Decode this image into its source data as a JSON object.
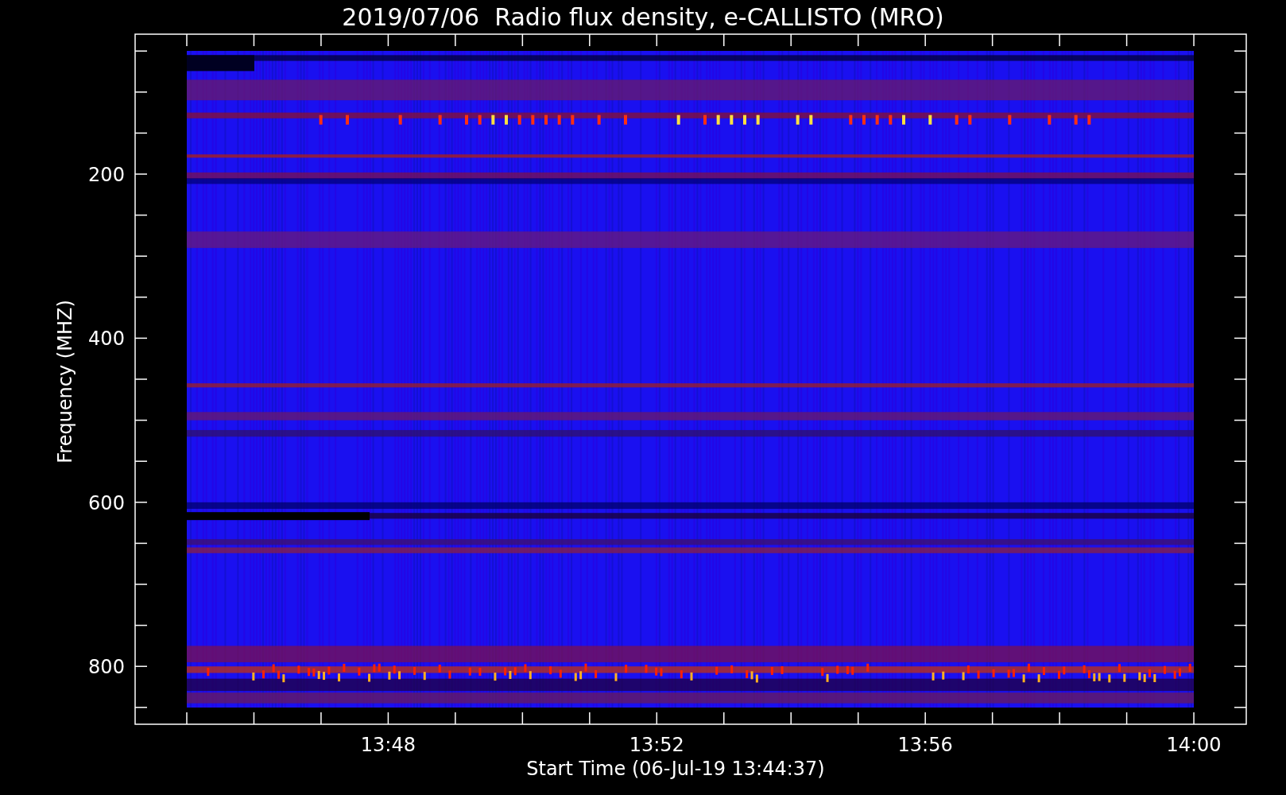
{
  "title": "2019/07/06  Radio flux density, e-CALLISTO (MRO)",
  "y_axis": {
    "label": "Frequency (MHZ)",
    "tick_labels": [
      "200",
      "400",
      "600",
      "800"
    ]
  },
  "x_axis": {
    "label": "Start Time (06-Jul-19 13:44:37)",
    "tick_labels": [
      "13:48",
      "13:52",
      "13:56",
      "14:00"
    ]
  }
}
